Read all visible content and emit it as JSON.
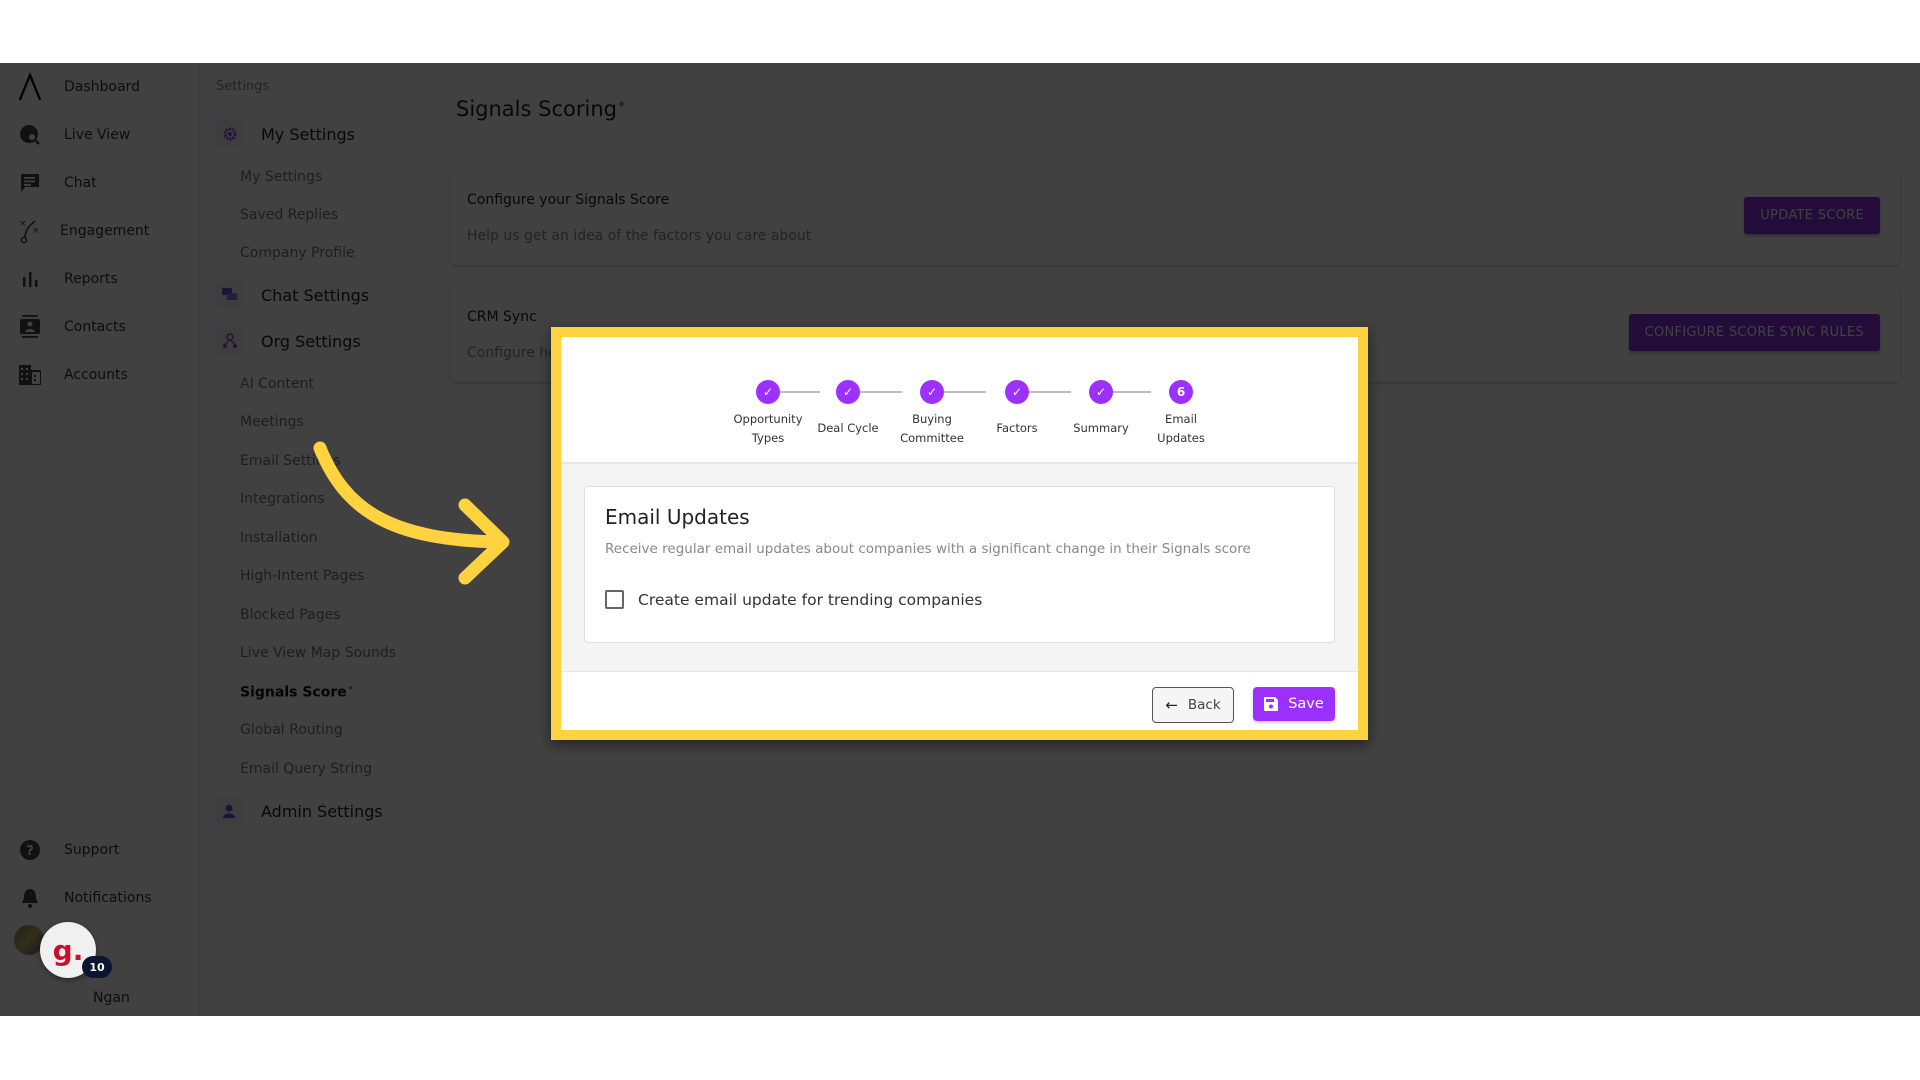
{
  "left_nav": {
    "items": [
      {
        "label": "Dashboard",
        "icon": "logo-icon"
      },
      {
        "label": "Live View",
        "icon": "globe-search-icon"
      },
      {
        "label": "Chat",
        "icon": "chat-icon"
      },
      {
        "label": "Engagement",
        "icon": "engagement-icon"
      },
      {
        "label": "Reports",
        "icon": "bar-chart-icon"
      },
      {
        "label": "Contacts",
        "icon": "contacts-icon"
      },
      {
        "label": "Accounts",
        "icon": "building-icon"
      }
    ],
    "bottom": [
      {
        "label": "Support",
        "icon": "help-icon"
      },
      {
        "label": "Notifications",
        "icon": "bell-icon"
      }
    ],
    "user_name": "Ngan",
    "widget_letter": "g.",
    "widget_badge": "10",
    "collapse_glyph": "‹"
  },
  "settings_panel": {
    "title": "Settings",
    "groups": [
      {
        "label": "My Settings",
        "items": [
          "My Settings",
          "Saved Replies",
          "Company Profile"
        ]
      },
      {
        "label": "Chat Settings",
        "items": []
      },
      {
        "label": "Org Settings",
        "items": [
          "AI Content",
          "Meetings",
          "Email Settings",
          "Integrations",
          "Installation",
          "High-Intent Pages",
          "Blocked Pages",
          "Live View Map Sounds",
          "Signals Score",
          "Global Routing",
          "Email Query String"
        ]
      },
      {
        "label": "Admin Settings",
        "items": []
      }
    ],
    "active_item": "Signals Score",
    "sparkle": "✦"
  },
  "main": {
    "title": "Signals Scoring",
    "title_sparkle": "✦",
    "cards": [
      {
        "title": "Configure your Signals Score",
        "description": "Help us get an idea of the factors you care about",
        "button": "UPDATE SCORE"
      },
      {
        "title": "CRM Sync",
        "description": "Configure how your Signals Score syncs to your CRM",
        "button": "CONFIGURE SCORE SYNC RULES"
      }
    ]
  },
  "modal": {
    "steps": [
      {
        "label_line1": "Opportunity",
        "label_line2": "Types",
        "status": "complete",
        "marker": "✓"
      },
      {
        "label_line1": "Deal Cycle",
        "label_line2": "",
        "status": "complete",
        "marker": "✓"
      },
      {
        "label_line1": "Buying",
        "label_line2": "Committee",
        "status": "complete",
        "marker": "✓"
      },
      {
        "label_line1": "Factors",
        "label_line2": "",
        "status": "complete",
        "marker": "✓"
      },
      {
        "label_line1": "Summary",
        "label_line2": "",
        "status": "complete",
        "marker": "✓"
      },
      {
        "label_line1": "Email",
        "label_line2": "Updates",
        "status": "active",
        "marker": "6"
      }
    ],
    "section_title": "Email Updates",
    "section_description": "Receive regular email updates about companies with a significant change in their Signals score",
    "checkbox_label": "Create email update for trending companies",
    "checkbox_checked": false,
    "back_label": "Back",
    "save_label": "Save"
  },
  "colors": {
    "accent": "#9b30ff",
    "highlight": "#ffd240",
    "sparkle": "#1aa3b5"
  }
}
